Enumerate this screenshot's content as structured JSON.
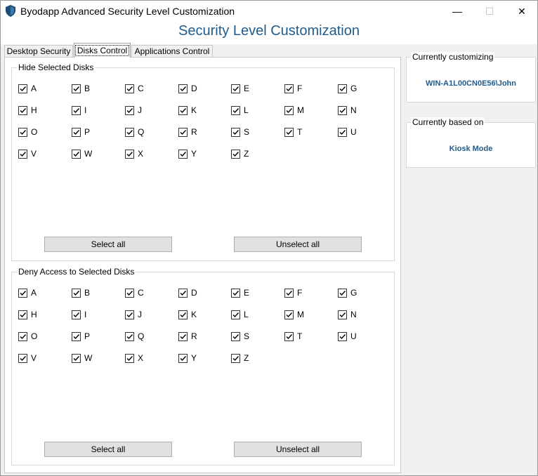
{
  "window": {
    "title": "Byodapp Advanced Security Level Customization",
    "minimize_glyph": "—",
    "maximize_glyph": "☐",
    "close_glyph": "✕",
    "icon": "shield-icon"
  },
  "header": {
    "title": "Security Level Customization"
  },
  "tabs": [
    {
      "label": "Desktop Security",
      "active": false
    },
    {
      "label": "Disks Control",
      "active": true
    },
    {
      "label": "Applications Control",
      "active": false
    }
  ],
  "hide_group": {
    "title": "Hide Selected Disks",
    "disks": [
      "A",
      "B",
      "C",
      "D",
      "E",
      "F",
      "G",
      "H",
      "I",
      "J",
      "K",
      "L",
      "M",
      "N",
      "O",
      "P",
      "Q",
      "R",
      "S",
      "T",
      "U",
      "V",
      "W",
      "X",
      "Y",
      "Z"
    ],
    "checked": true,
    "select_all_label": "Select all",
    "unselect_all_label": "Unselect all"
  },
  "deny_group": {
    "title": "Deny Access to Selected Disks",
    "disks": [
      "A",
      "B",
      "C",
      "D",
      "E",
      "F",
      "G",
      "H",
      "I",
      "J",
      "K",
      "L",
      "M",
      "N",
      "O",
      "P",
      "Q",
      "R",
      "S",
      "T",
      "U",
      "V",
      "W",
      "X",
      "Y",
      "Z"
    ],
    "checked": true,
    "select_all_label": "Select all",
    "unselect_all_label": "Unselect all"
  },
  "sidebar": {
    "customizing_title": "Currently customizing",
    "customizing_value": "WIN-A1L00CN0E56\\John",
    "based_on_title": "Currently based on",
    "based_on_value": "Kiosk Mode"
  },
  "colors": {
    "accent": "#1f5b8c",
    "button_bg": "#e1e1e1",
    "window_bg": "#f0f0f0"
  }
}
